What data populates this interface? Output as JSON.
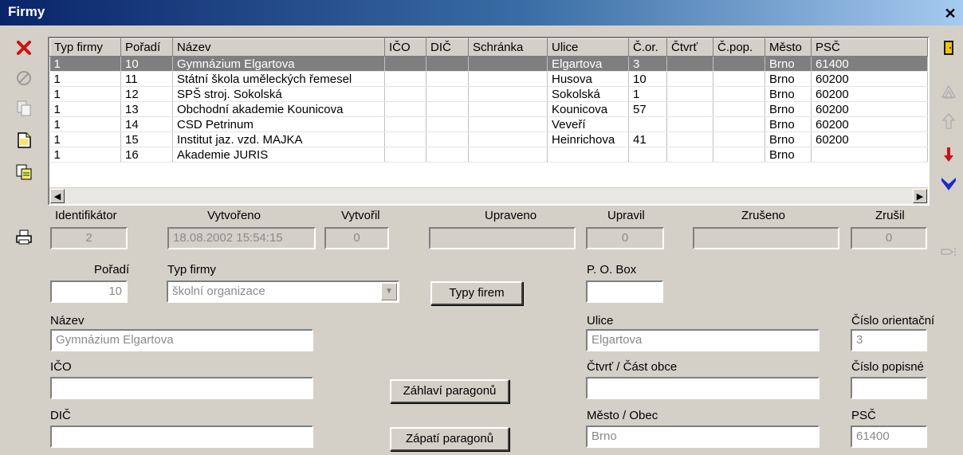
{
  "window": {
    "title": "Firmy",
    "close_glyph": "✕"
  },
  "grid": {
    "columns": [
      "Typ firmy",
      "Pořadí",
      "Název",
      "IČO",
      "DIČ",
      "Schránka",
      "Ulice",
      "Č.or.",
      "Čtvrť",
      "Č.pop.",
      "Město",
      "PSČ"
    ],
    "rows": [
      [
        "1",
        "10",
        "Gymnázium Elgartova",
        "",
        "",
        "",
        "Elgartova",
        "3",
        "",
        "",
        "Brno",
        "61400"
      ],
      [
        "1",
        "11",
        "Státní škola uměleckých řemesel",
        "",
        "",
        "",
        "Husova",
        "10",
        "",
        "",
        "Brno",
        "60200"
      ],
      [
        "1",
        "12",
        "SPŠ stroj. Sokolská",
        "",
        "",
        "",
        "Sokolská",
        "1",
        "",
        "",
        "Brno",
        "60200"
      ],
      [
        "1",
        "13",
        "Obchodní akademie Kounicova",
        "",
        "",
        "",
        "Kounicova",
        "57",
        "",
        "",
        "Brno",
        "60200"
      ],
      [
        "1",
        "14",
        "CSD Petrinum",
        "",
        "",
        "",
        "Veveří",
        "",
        "",
        "",
        "Brno",
        "60200"
      ],
      [
        "1",
        "15",
        "Institut jaz. vzd. MAJKA",
        "",
        "",
        "",
        "Heinrichova",
        "41",
        "",
        "",
        "Brno",
        "60200"
      ],
      [
        "1",
        "16",
        "Akademie JURIS",
        "",
        "",
        "",
        "",
        "",
        "",
        "",
        "Brno",
        ""
      ]
    ],
    "selected_row": 0,
    "scroll_left_glyph": "◀",
    "scroll_right_glyph": "▶"
  },
  "toolbar_left": [
    {
      "name": "delete-icon"
    },
    {
      "name": "cancel-icon"
    },
    {
      "name": "copy-record-icon"
    },
    {
      "name": "new-record-icon"
    },
    {
      "name": "duplicate-record-icon"
    },
    {
      "name": "print-icon"
    }
  ],
  "toolbar_right": [
    {
      "name": "exit-door-icon"
    },
    {
      "name": "move-first-icon"
    },
    {
      "name": "move-up-icon"
    },
    {
      "name": "move-down-icon"
    },
    {
      "name": "move-last-icon"
    },
    {
      "name": "next-page-icon"
    }
  ],
  "form": {
    "identifikator": {
      "label": "Identifikátor",
      "value": "2"
    },
    "vytvoreno": {
      "label": "Vytvořeno",
      "value": "18.08.2002 15:54:15"
    },
    "vytvoril": {
      "label": "Vytvořil",
      "value": "0"
    },
    "upraveno": {
      "label": "Upraveno",
      "value": ""
    },
    "upravil": {
      "label": "Upravil",
      "value": "0"
    },
    "zruseno": {
      "label": "Zrušeno",
      "value": ""
    },
    "zrusil": {
      "label": "Zrušil",
      "value": "0"
    },
    "poradi": {
      "label": "Pořadí",
      "value": "10"
    },
    "typ_firmy": {
      "label": "Typ firmy",
      "value": "školní organizace",
      "arrow_glyph": "▼"
    },
    "typy_firem_button": "Typy firem",
    "po_box": {
      "label": "P. O. Box",
      "value": ""
    },
    "nazev": {
      "label": "Název",
      "value": "Gymnázium Elgartova"
    },
    "ulice": {
      "label": "Ulice",
      "value": "Elgartova"
    },
    "cislo_orientacni": {
      "label": "Číslo orientační",
      "value": "3"
    },
    "ico": {
      "label": "IČO",
      "value": ""
    },
    "zahlavi_button": "Záhlaví paragonů",
    "ctvrt": {
      "label": "Čtvrť / Část obce",
      "value": ""
    },
    "cislo_popisne": {
      "label": "Číslo popisné",
      "value": ""
    },
    "dic": {
      "label": "DIČ",
      "value": ""
    },
    "zapati_button": "Zápatí paragonů",
    "mesto": {
      "label": "Město / Obec",
      "value": "Brno"
    },
    "psc": {
      "label": "PSČ",
      "value": "61400"
    }
  },
  "colors": {
    "titlebar_start": "#0a246a",
    "titlebar_end": "#a6caf0",
    "selected_row": "#7f7f7f",
    "window_bg": "#d4d0c8"
  }
}
